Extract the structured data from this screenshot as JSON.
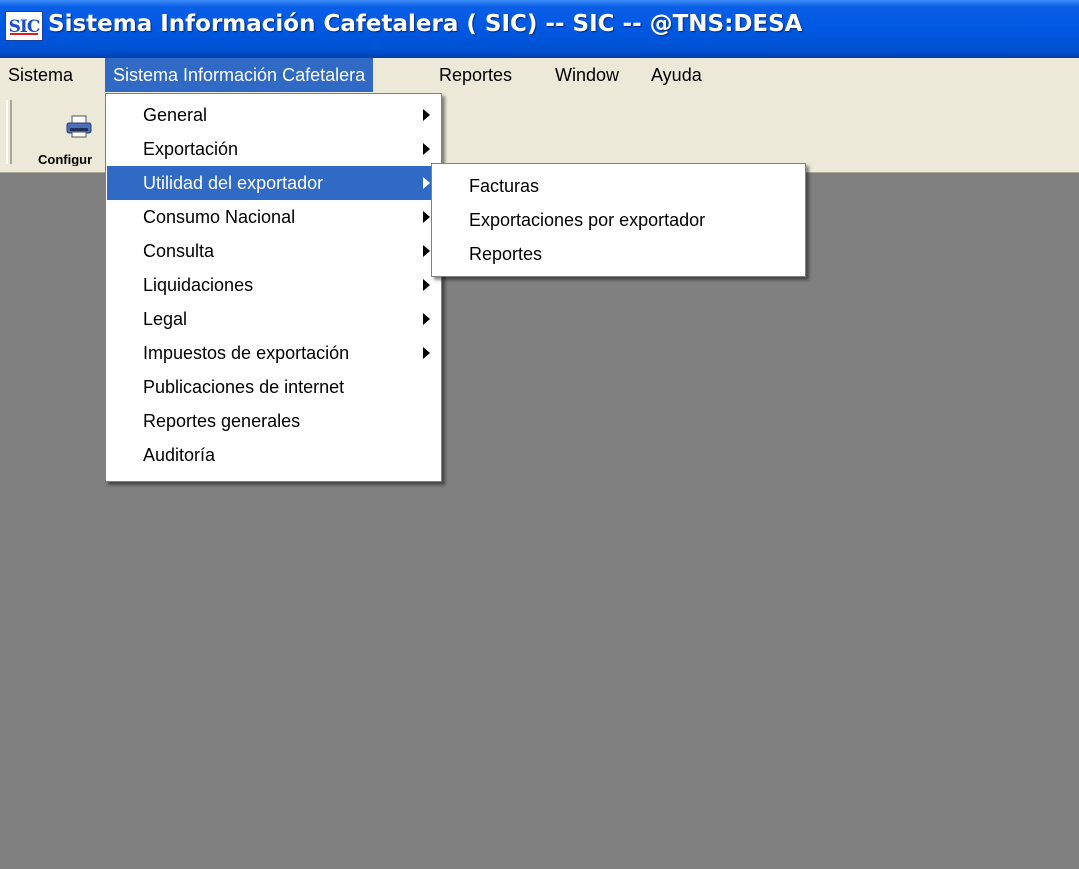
{
  "window": {
    "icon_text": "SIC",
    "title": "Sistema Información Cafetalera ( SIC) -- SIC -- @TNS:DESA"
  },
  "menubar": {
    "items": [
      {
        "label": "Sistema"
      },
      {
        "label": "Sistema Información Cafetalera"
      },
      {
        "label": "Reportes"
      },
      {
        "label": "Window"
      },
      {
        "label": "Ayuda"
      }
    ]
  },
  "toolbar": {
    "button_label": "Configur",
    "button_icon": "printer-icon"
  },
  "dropdown": {
    "items": [
      {
        "label": "General",
        "submenu": true
      },
      {
        "label": "Exportación",
        "submenu": true
      },
      {
        "label": "Utilidad del exportador",
        "submenu": true
      },
      {
        "label": "Consumo Nacional",
        "submenu": true
      },
      {
        "label": "Consulta",
        "submenu": true
      },
      {
        "label": "Liquidaciones",
        "submenu": true
      },
      {
        "label": "Legal",
        "submenu": true
      },
      {
        "label": "Impuestos de exportación",
        "submenu": true
      },
      {
        "label": "Publicaciones de internet",
        "submenu": false
      },
      {
        "label": "Reportes generales",
        "submenu": false
      },
      {
        "label": "Auditoría",
        "submenu": false
      }
    ]
  },
  "submenu": {
    "items": [
      {
        "label": "Facturas"
      },
      {
        "label": "Exportaciones por exportador"
      },
      {
        "label": "Reportes"
      }
    ]
  },
  "colors": {
    "titlebar": "#0058e2",
    "menubar": "#ece9d8",
    "highlight": "#316ac5",
    "workspace": "#808080"
  }
}
